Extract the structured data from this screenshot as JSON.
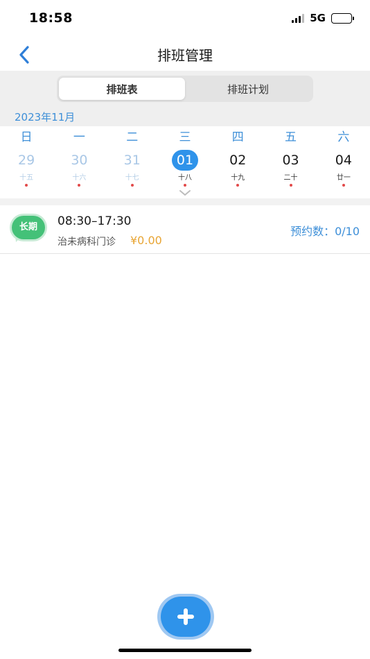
{
  "status_bar": {
    "time": "18:58",
    "network": "5G"
  },
  "nav": {
    "title": "排班管理"
  },
  "segment": {
    "tabs": [
      {
        "label": "排班表",
        "active": true
      },
      {
        "label": "排班计划",
        "active": false
      }
    ]
  },
  "calendar": {
    "month": "2023年11月",
    "weekdays": [
      "日",
      "一",
      "二",
      "三",
      "四",
      "五",
      "六"
    ],
    "dates": [
      {
        "day": "29",
        "lunar": "十五"
      },
      {
        "day": "30",
        "lunar": "十六"
      },
      {
        "day": "31",
        "lunar": "十七"
      },
      {
        "day": "01",
        "lunar": "十八"
      },
      {
        "day": "02",
        "lunar": "十九"
      },
      {
        "day": "03",
        "lunar": "二十"
      },
      {
        "day": "04",
        "lunar": "廿一"
      }
    ]
  },
  "schedule": {
    "badge": "长期",
    "time_range": "08:30–17:30",
    "clinic": "治未病科门诊",
    "fee": "¥0.00",
    "booking": "预约数：0/10"
  },
  "colors": {
    "accent": "#2f93ea",
    "badge_green": "#44c178",
    "fee": "#e8a534",
    "dot": "#e24a4a"
  },
  "icons": {
    "back": "chevron-left-icon",
    "expand": "chevron-down-icon",
    "add": "plus-icon"
  }
}
